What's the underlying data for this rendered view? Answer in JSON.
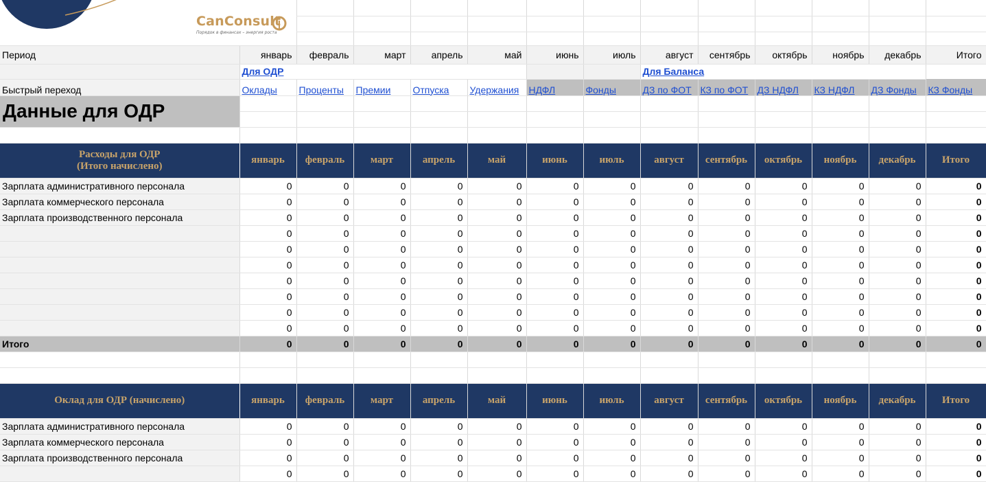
{
  "logo": {
    "brand": "CanConsult",
    "tagline": "Порядок в финансах – энергия роста"
  },
  "months": [
    "январь",
    "февраль",
    "март",
    "апрель",
    "май",
    "июнь",
    "июль",
    "август",
    "сентябрь",
    "октябрь",
    "ноябрь",
    "декабрь"
  ],
  "total_label": "Итого",
  "period_label": "Период",
  "quick_nav_label": "Быстрый переход",
  "nav_group_odr": "Для ОДР",
  "nav_group_balance": "Для Баланса",
  "nav_links": [
    "Оклады",
    "Проценты",
    "Премии",
    "Отпуска",
    "Удержания",
    "НДФЛ",
    "Фонды",
    "ДЗ по ФОТ",
    "КЗ по ФОТ",
    "ДЗ НДФЛ",
    "КЗ НДФЛ",
    "ДЗ Фонды",
    "КЗ Фонды"
  ],
  "section_title": "Данные для ОДР",
  "block1": {
    "header_line1": "Расходы для ОДР",
    "header_line2": "(Итого начислено)",
    "rows": [
      "Зарплата административного персонала",
      "Зарплата коммерческого персонала",
      "Зарплата производственного персонала",
      "",
      "",
      "",
      "",
      "",
      "",
      ""
    ],
    "total_row_label": "Итого"
  },
  "block2": {
    "header": "Оклад для ОДР (начислено)",
    "rows": [
      "Зарплата административного персонала",
      "Зарплата коммерческого персонала",
      "Зарплата производственного персонала",
      ""
    ]
  },
  "zero": "0"
}
